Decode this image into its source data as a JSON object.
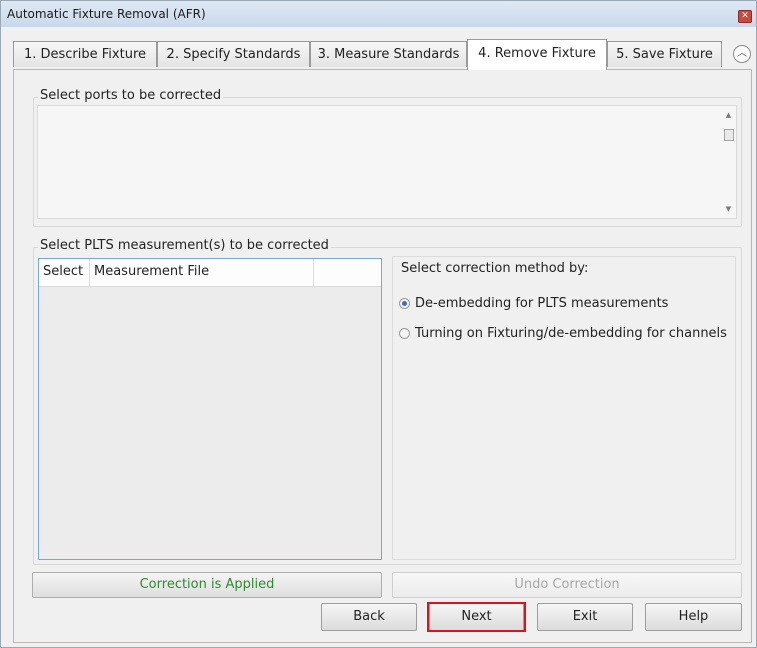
{
  "window": {
    "title": "Automatic Fixture Removal (AFR)"
  },
  "tabs": [
    {
      "label": "1. Describe Fixture"
    },
    {
      "label": "2. Specify Standards"
    },
    {
      "label": "3. Measure Standards"
    },
    {
      "label": "4. Remove Fixture"
    },
    {
      "label": "5. Save Fixture"
    }
  ],
  "ports": {
    "label": "Select ports to be corrected"
  },
  "measurements": {
    "label": "Select PLTS measurement(s) to be corrected",
    "columns": [
      "Select",
      "Measurement File",
      ""
    ]
  },
  "correction": {
    "label": "Select correction method by:",
    "options": [
      {
        "label": "De-embedding for PLTS measurements",
        "selected": true
      },
      {
        "label": "Turning on Fixturing/de-embedding  for channels",
        "selected": false
      }
    ]
  },
  "status": {
    "applied_label": "Correction is Applied",
    "applied_color": "#2e8b2e",
    "undo_label": "Undo Correction"
  },
  "buttons": {
    "back": "Back",
    "next": "Next",
    "exit": "Exit",
    "help": "Help"
  },
  "colors": {
    "accent": "#3c6fb8",
    "highlight": "#d9141d"
  }
}
